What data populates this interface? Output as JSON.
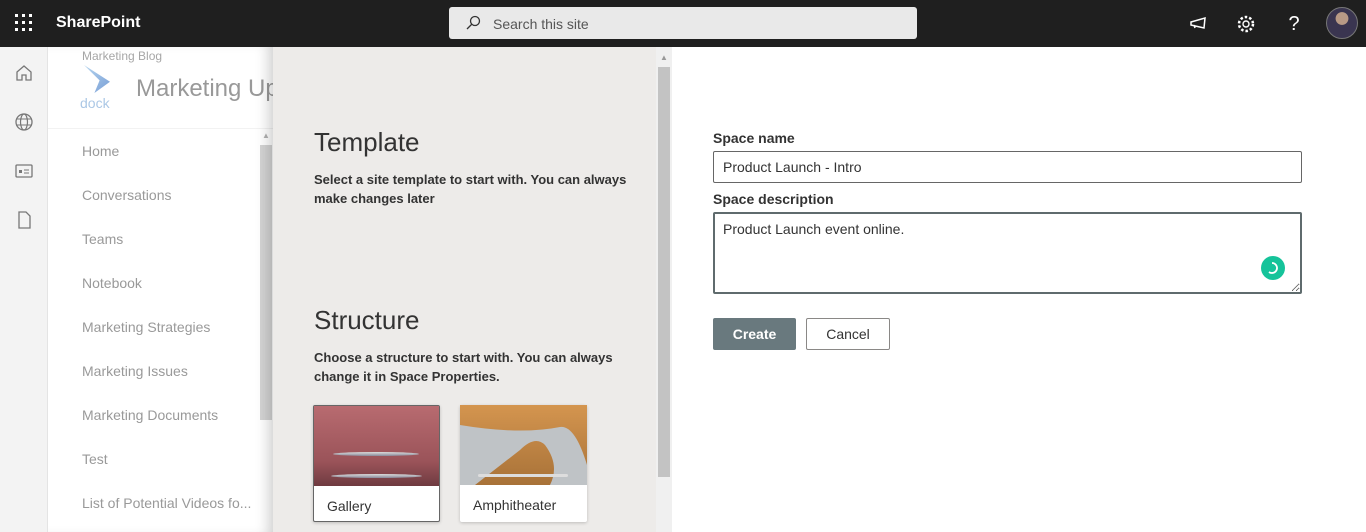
{
  "topbar": {
    "app_name": "SharePoint",
    "search_placeholder": "Search this site"
  },
  "site": {
    "blog_name": "Marketing Blog",
    "logo_text": "dock",
    "title": "Marketing Up",
    "nav": [
      "Home",
      "Conversations",
      "Teams",
      "Notebook",
      "Marketing Strategies",
      "Marketing Issues",
      "Marketing Documents",
      "Test",
      "List of Potential Videos fo..."
    ]
  },
  "panel": {
    "template_heading": "Template",
    "template_desc": "Select a site template to start with. You can always make changes later",
    "structure_heading": "Structure",
    "structure_desc": "Choose a structure to start with. You can always change it in Space Properties.",
    "cards": [
      "Gallery",
      "Amphitheater"
    ]
  },
  "form": {
    "name_label": "Space name",
    "name_value": "Product Launch - Intro",
    "desc_label": "Space description",
    "desc_value": "Product Launch event online.",
    "create": "Create",
    "cancel": "Cancel"
  },
  "colors": {
    "topbar": "#1f1f1f",
    "panel": "#edebe9",
    "create": "#69797e",
    "grammarly": "#15c39a"
  }
}
